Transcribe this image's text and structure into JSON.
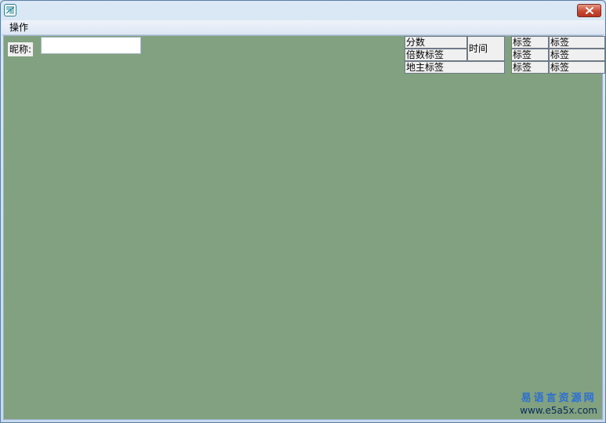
{
  "titlebar": {
    "title": "",
    "icon": "app-logo-icon",
    "close_icon": "close-x-icon"
  },
  "menu": {
    "items": [
      {
        "label": "操作"
      }
    ]
  },
  "form": {
    "nickname_label": "昵称:",
    "nickname_value": ""
  },
  "score_panel": {
    "score": "分数",
    "multiplier": "倍数标签",
    "landlord": "地主标签",
    "time": "时间"
  },
  "label_grid": {
    "rows": [
      [
        "标签",
        "标签"
      ],
      [
        "标签",
        "标签"
      ],
      [
        "标签",
        "标签"
      ]
    ]
  },
  "watermark": {
    "name": "易语言资源网",
    "url": "www.e5a5x.com"
  },
  "colors": {
    "client_background": "#81a180",
    "label_background": "#f0f0f0",
    "close_button": "#c74a35"
  }
}
